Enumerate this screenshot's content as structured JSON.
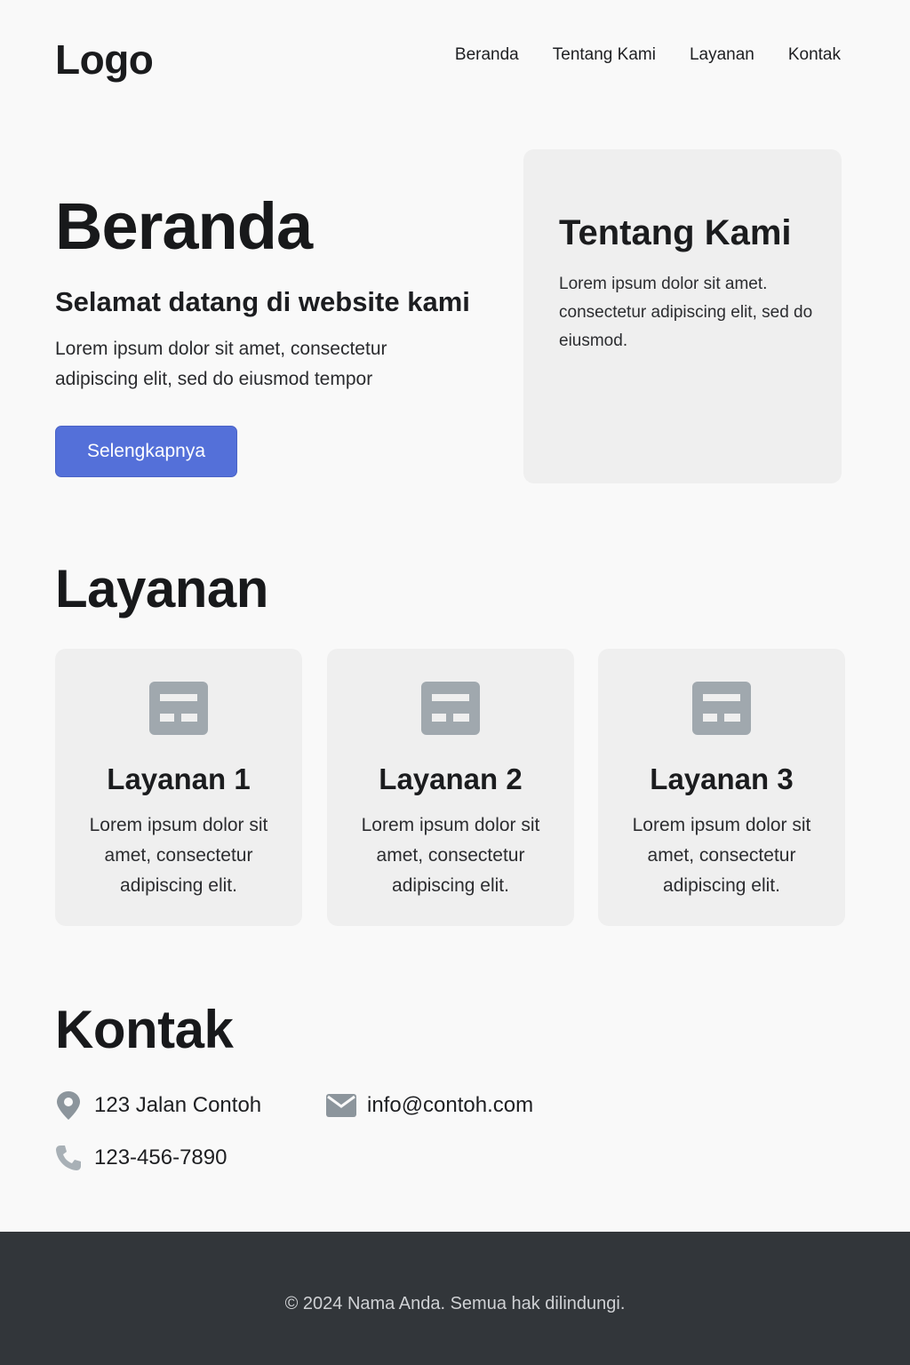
{
  "header": {
    "logo": "Logo",
    "nav": [
      "Beranda",
      "Tentang Kami",
      "Layanan",
      "Kontak"
    ]
  },
  "hero": {
    "title": "Beranda",
    "subtitle": "Selamat datang di website kami",
    "text": "Lorem ipsum dolor sit amet, consectetur adipiscing elit, sed do eiusmod tempor",
    "button_label": "Selengkapnya"
  },
  "about": {
    "title": "Tentang Kami",
    "text": "Lorem ipsum dolor sit amet. consectetur adipiscing elit, sed do eiusmod."
  },
  "services": {
    "title": "Layanan",
    "items": [
      {
        "name": "Layanan 1",
        "text": "Lorem ipsum dolor sit amet, consectetur adipiscing elit.",
        "icon": "layout-icon"
      },
      {
        "name": "Layanan 2",
        "text": "Lorem ipsum dolor sit amet, consectetur adipiscing elit.",
        "icon": "layout-icon"
      },
      {
        "name": "Layanan 3",
        "text": "Lorem ipsum dolor sit amet, consectetur adipiscing elit.",
        "icon": "layout-icon"
      }
    ]
  },
  "contact": {
    "title": "Kontak",
    "address": "123 Jalan Contoh",
    "email": "info@contoh.com",
    "phone": "123-456-7890"
  },
  "footer": {
    "text": "© 2024 Nama Anda. Semua hak dilindungi."
  },
  "colors": {
    "accent": "#5470d9",
    "footer_bg": "#32363a",
    "card_bg": "#efefef",
    "icon_gray": "#a0a8ae"
  }
}
